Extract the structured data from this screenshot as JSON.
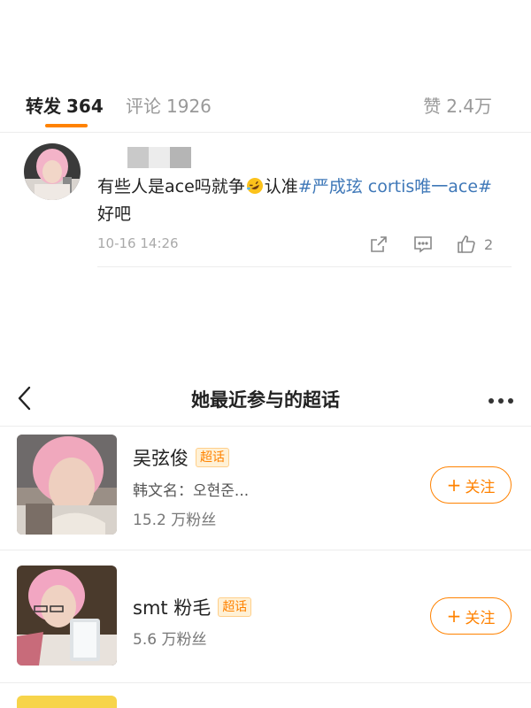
{
  "tabs": {
    "repost": {
      "label": "转发",
      "count": "364"
    },
    "comment": {
      "label": "评论",
      "count": "1926"
    },
    "like": {
      "label": "赞",
      "count": "2.4万"
    }
  },
  "comment": {
    "text_parts": {
      "part1": "有些人是ace吗就争",
      "part2": "认准",
      "hashtag": "#严成玹 cortis唯一ace#",
      "part3": " 好吧"
    },
    "time": "10-16 14:26",
    "like_count": "2"
  },
  "header": {
    "title": "她最近参与的超话"
  },
  "topics": [
    {
      "name": "吴弦俊",
      "badge": "超话",
      "subtitle": "韩文名：오현준...",
      "fans": "15.2 万粉丝",
      "follow_label": "关注"
    },
    {
      "name": "smt 粉毛",
      "badge": "超话",
      "fans": "5.6 万粉丝",
      "follow_label": "关注"
    }
  ],
  "icons": {
    "share": "share-icon",
    "reply": "comment-icon",
    "like": "thumbs-up-icon",
    "back": "chevron-left-icon",
    "more": "more-dots-icon",
    "emoji": "rofl-emoji-icon"
  },
  "colors": {
    "accent": "#ff8200",
    "hashtag": "#3f78b8",
    "badge_bg": "#fff1d6"
  }
}
